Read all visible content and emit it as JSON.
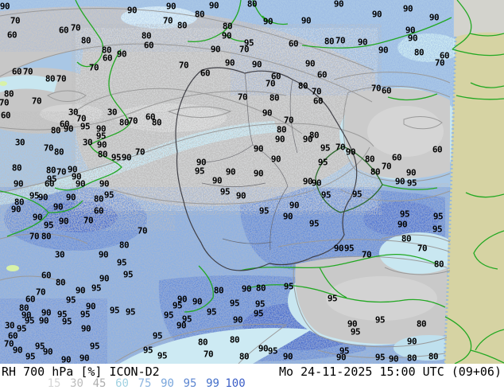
{
  "map": {
    "parameter": "RH 700 hPa [%]",
    "model": "ICON-D2",
    "title_left": "RH 700 hPa [%] ICON-D2",
    "valid_time": "Mo 24-11-2025 15:00 UTC (09+06)",
    "labels": [
      [
        90,
        6,
        8
      ],
      [
        90,
        166,
        13
      ],
      [
        90,
        215,
        8
      ],
      [
        90,
        269,
        7
      ],
      [
        80,
        251,
        18
      ],
      [
        80,
        317,
        5
      ],
      [
        90,
        385,
        26
      ],
      [
        90,
        426,
        5
      ],
      [
        90,
        474,
        18
      ],
      [
        90,
        513,
        11
      ],
      [
        90,
        546,
        22
      ],
      [
        70,
        19,
        26
      ],
      [
        70,
        211,
        26
      ],
      [
        80,
        229,
        32
      ],
      [
        80,
        286,
        33
      ],
      [
        90,
        337,
        27
      ],
      [
        90,
        285,
        45
      ],
      [
        80,
        184,
        45
      ],
      [
        60,
        15,
        44
      ],
      [
        60,
        80,
        38
      ],
      [
        70,
        95,
        35
      ],
      [
        90,
        516,
        38
      ],
      [
        90,
        519,
        48
      ],
      [
        80,
        108,
        51
      ],
      [
        80,
        134,
        63
      ],
      [
        60,
        187,
        57
      ],
      [
        95,
        313,
        54
      ],
      [
        90,
        456,
        53
      ],
      [
        80,
        414,
        52
      ],
      [
        70,
        428,
        51
      ],
      [
        60,
        369,
        55
      ],
      [
        90,
        153,
        68
      ],
      [
        90,
        271,
        62
      ],
      [
        70,
        307,
        62
      ],
      [
        60,
        135,
        73
      ],
      [
        90,
        482,
        63
      ],
      [
        80,
        527,
        66
      ],
      [
        60,
        559,
        70
      ],
      [
        70,
        553,
        79
      ],
      [
        70,
        118,
        85
      ],
      [
        70,
        231,
        82
      ],
      [
        60,
        258,
        92
      ],
      [
        90,
        289,
        79
      ],
      [
        90,
        323,
        81
      ],
      [
        90,
        390,
        80
      ],
      [
        60,
        21,
        90
      ],
      [
        70,
        35,
        90
      ],
      [
        80,
        63,
        99
      ],
      [
        70,
        77,
        99
      ],
      [
        60,
        347,
        96
      ],
      [
        60,
        405,
        94
      ],
      [
        80,
        11,
        118
      ],
      [
        70,
        5,
        129
      ],
      [
        70,
        46,
        127
      ],
      [
        70,
        305,
        122
      ],
      [
        80,
        345,
        123
      ],
      [
        70,
        340,
        105
      ],
      [
        80,
        381,
        108
      ],
      [
        70,
        398,
        115
      ],
      [
        60,
        400,
        127
      ],
      [
        70,
        473,
        111
      ],
      [
        60,
        486,
        114
      ],
      [
        60,
        7,
        145
      ],
      [
        30,
        92,
        141
      ],
      [
        30,
        141,
        141
      ],
      [
        70,
        102,
        149
      ],
      [
        90,
        336,
        142
      ],
      [
        60,
        189,
        147
      ],
      [
        70,
        167,
        152
      ],
      [
        80,
        156,
        154
      ],
      [
        80,
        197,
        154
      ],
      [
        95,
        107,
        159
      ],
      [
        60,
        81,
        156
      ],
      [
        70,
        363,
        151
      ],
      [
        80,
        70,
        164
      ],
      [
        90,
        86,
        162
      ],
      [
        90,
        127,
        162
      ],
      [
        95,
        127,
        171
      ],
      [
        80,
        354,
        163
      ],
      [
        90,
        352,
        175
      ],
      [
        90,
        387,
        175
      ],
      [
        80,
        395,
        170
      ],
      [
        30,
        25,
        179
      ],
      [
        30,
        110,
        179
      ],
      [
        70,
        61,
        186
      ],
      [
        80,
        74,
        191
      ],
      [
        90,
        128,
        182
      ],
      [
        95,
        409,
        186
      ],
      [
        70,
        428,
        185
      ],
      [
        90,
        441,
        191
      ],
      [
        60,
        550,
        188
      ],
      [
        70,
        176,
        191
      ],
      [
        80,
        129,
        194
      ],
      [
        95,
        146,
        198
      ],
      [
        90,
        159,
        198
      ],
      [
        80,
        465,
        200
      ],
      [
        60,
        499,
        198
      ],
      [
        90,
        325,
        187
      ],
      [
        80,
        21,
        211
      ],
      [
        80,
        64,
        214
      ],
      [
        70,
        77,
        216
      ],
      [
        90,
        91,
        213
      ],
      [
        90,
        347,
        200
      ],
      [
        95,
        406,
        204
      ],
      [
        90,
        253,
        204
      ],
      [
        95,
        65,
        225
      ],
      [
        90,
        96,
        222
      ],
      [
        90,
        290,
        216
      ],
      [
        90,
        325,
        218
      ],
      [
        70,
        486,
        209
      ],
      [
        80,
        472,
        216
      ],
      [
        90,
        517,
        217
      ],
      [
        95,
        251,
        215
      ],
      [
        90,
        101,
        231
      ],
      [
        90,
        131,
        231
      ],
      [
        60,
        62,
        231
      ],
      [
        90,
        23,
        231
      ],
      [
        90,
        503,
        228
      ],
      [
        95,
        518,
        230
      ],
      [
        90,
        387,
        228
      ],
      [
        90,
        273,
        227
      ],
      [
        90,
        398,
        230
      ],
      [
        95,
        43,
        246
      ],
      [
        90,
        54,
        248
      ],
      [
        90,
        89,
        248
      ],
      [
        80,
        124,
        250
      ],
      [
        95,
        137,
        245
      ],
      [
        95,
        283,
        241
      ],
      [
        95,
        410,
        245
      ],
      [
        95,
        449,
        244
      ],
      [
        90,
        303,
        246
      ],
      [
        80,
        24,
        254
      ],
      [
        90,
        20,
        263
      ],
      [
        90,
        73,
        260
      ],
      [
        60,
        124,
        265
      ],
      [
        95,
        332,
        265
      ],
      [
        90,
        370,
        258
      ],
      [
        95,
        509,
        269
      ],
      [
        95,
        551,
        272
      ],
      [
        90,
        47,
        273
      ],
      [
        70,
        111,
        277
      ],
      [
        90,
        80,
        278
      ],
      [
        95,
        61,
        283
      ],
      [
        90,
        362,
        272
      ],
      [
        90,
        506,
        282
      ],
      [
        95,
        550,
        288
      ],
      [
        95,
        395,
        281
      ],
      [
        70,
        43,
        297
      ],
      [
        80,
        58,
        297
      ],
      [
        70,
        179,
        290
      ],
      [
        80,
        156,
        308
      ],
      [
        80,
        511,
        300
      ],
      [
        30,
        75,
        320
      ],
      [
        95,
        153,
        330
      ],
      [
        90,
        130,
        320
      ],
      [
        70,
        531,
        312
      ],
      [
        90,
        426,
        312
      ],
      [
        95,
        439,
        312
      ],
      [
        70,
        461,
        320
      ],
      [
        80,
        552,
        332
      ],
      [
        60,
        58,
        346
      ],
      [
        95,
        161,
        345
      ],
      [
        90,
        131,
        350
      ],
      [
        95,
        121,
        362
      ],
      [
        90,
        101,
        365
      ],
      [
        80,
        76,
        355
      ],
      [
        70,
        51,
        367
      ],
      [
        80,
        275,
        365
      ],
      [
        90,
        310,
        363
      ],
      [
        80,
        328,
        362
      ],
      [
        95,
        363,
        360
      ],
      [
        60,
        38,
        376
      ],
      [
        95,
        89,
        377
      ],
      [
        90,
        114,
        385
      ],
      [
        90,
        229,
        376
      ],
      [
        95,
        223,
        384
      ],
      [
        90,
        248,
        379
      ],
      [
        95,
        295,
        381
      ],
      [
        95,
        327,
        382
      ],
      [
        95,
        418,
        375
      ],
      [
        80,
        30,
        387
      ],
      [
        90,
        33,
        396
      ],
      [
        90,
        58,
        393
      ],
      [
        95,
        78,
        395
      ],
      [
        95,
        107,
        395
      ],
      [
        95,
        144,
        390
      ],
      [
        95,
        164,
        392
      ],
      [
        95,
        212,
        396
      ],
      [
        95,
        266,
        392
      ],
      [
        95,
        325,
        394
      ],
      [
        95,
        478,
        402
      ],
      [
        90,
        299,
        402
      ],
      [
        95,
        235,
        401
      ],
      [
        90,
        55,
        403
      ],
      [
        95,
        84,
        404
      ],
      [
        95,
        37,
        403
      ],
      [
        30,
        12,
        409
      ],
      [
        90,
        108,
        413
      ],
      [
        95,
        27,
        413
      ],
      [
        90,
        443,
        407
      ],
      [
        80,
        530,
        407
      ],
      [
        95,
        447,
        417
      ],
      [
        95,
        198,
        422
      ],
      [
        60,
        16,
        422
      ],
      [
        90,
        228,
        409
      ],
      [
        95,
        50,
        435
      ],
      [
        95,
        119,
        435
      ],
      [
        70,
        11,
        432
      ],
      [
        90,
        22,
        440
      ],
      [
        90,
        60,
        442
      ],
      [
        95,
        186,
        440
      ],
      [
        80,
        255,
        430
      ],
      [
        80,
        295,
        427
      ],
      [
        90,
        331,
        438
      ],
      [
        95,
        343,
        441
      ],
      [
        90,
        518,
        429
      ],
      [
        95,
        433,
        441
      ],
      [
        95,
        38,
        448
      ],
      [
        90,
        83,
        452
      ],
      [
        90,
        106,
        450
      ],
      [
        95,
        204,
        447
      ],
      [
        70,
        262,
        445
      ],
      [
        80,
        307,
        448
      ],
      [
        90,
        362,
        448
      ],
      [
        90,
        429,
        449
      ],
      [
        95,
        478,
        449
      ],
      [
        90,
        495,
        451
      ],
      [
        80,
        518,
        450
      ],
      [
        80,
        545,
        448
      ]
    ]
  },
  "legend": {
    "values": [
      "15",
      "30",
      "45",
      "60",
      "75",
      "90",
      "95",
      "99",
      "100"
    ],
    "colors": [
      "#d6d6d6",
      "#bdbdbd",
      "#adadad",
      "#a2d2e2",
      "#8fb6e0",
      "#79a6dc",
      "#5e87d1",
      "#4571ca",
      "#3a5dc6"
    ]
  },
  "palette": {
    "dry_gray": "#c6c6c6",
    "rh60_cyan": "#c8e6f0",
    "rh75_lightblue": "#a9c7e5",
    "rh90_blue": "#7da0db",
    "rh95_blue": "#5f84d2",
    "rh99_blue": "#3f63c6",
    "outside_domain_land": "#d6d3a3",
    "outside_domain_sea": "#d3d3cd",
    "border_green": "#22a822",
    "germany_border": "#3f3f46",
    "contour_gray": "#9a9a9a",
    "very_dry_green": "#d8f2a8"
  }
}
